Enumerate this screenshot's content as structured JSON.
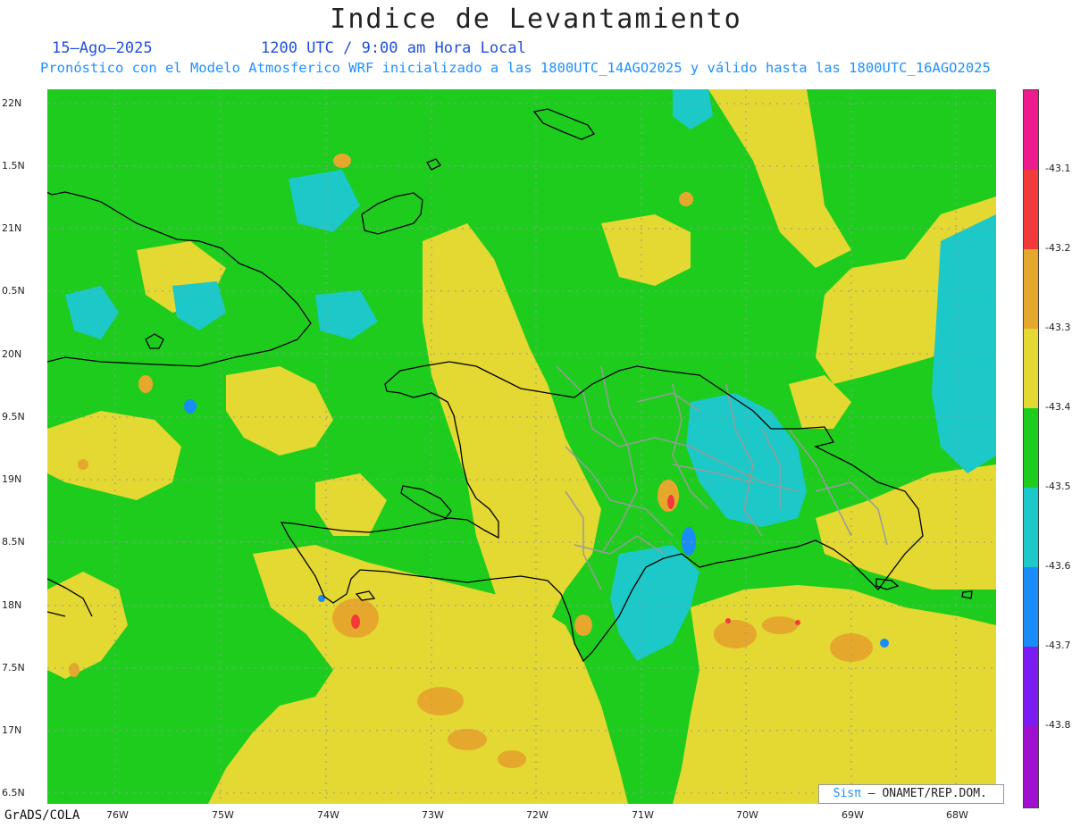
{
  "title": "Indice de Levantamiento",
  "date": "15–Ago–2025",
  "time": "1200 UTC / 9:00 am Hora Local",
  "forecast_note": "Pronóstico con el Modelo Atmosferico WRF inicializado a las 1800UTC_14AGO2025 y válido hasta las  1800UTC_16AGO2025",
  "lat_labels": [
    "22N",
    "1.5N",
    "21N",
    "0.5N",
    "20N",
    "9.5N",
    "19N",
    "8.5N",
    "18N",
    "7.5N",
    "17N",
    "6.5N"
  ],
  "lon_labels": [
    "76W",
    "75W",
    "74W",
    "73W",
    "72W",
    "71W",
    "70W",
    "69W",
    "68W"
  ],
  "colorbar_labels": [
    "-43.1",
    "-43.2",
    "-43.3",
    "-43.4",
    "-43.5",
    "-43.6",
    "-43.7",
    "-43.8"
  ],
  "colorbar_colors": [
    "#ee1b8f",
    "#f23a3a",
    "#e6a82c",
    "#e4d832",
    "#1ecc1e",
    "#1cc8c8",
    "#1a8cf7",
    "#7d1cf0",
    "#a010d0"
  ],
  "software": "GrADS/COLA",
  "credit_brand": "Sisπ",
  "credit_org": " – ONAMET/REP.DOM."
}
